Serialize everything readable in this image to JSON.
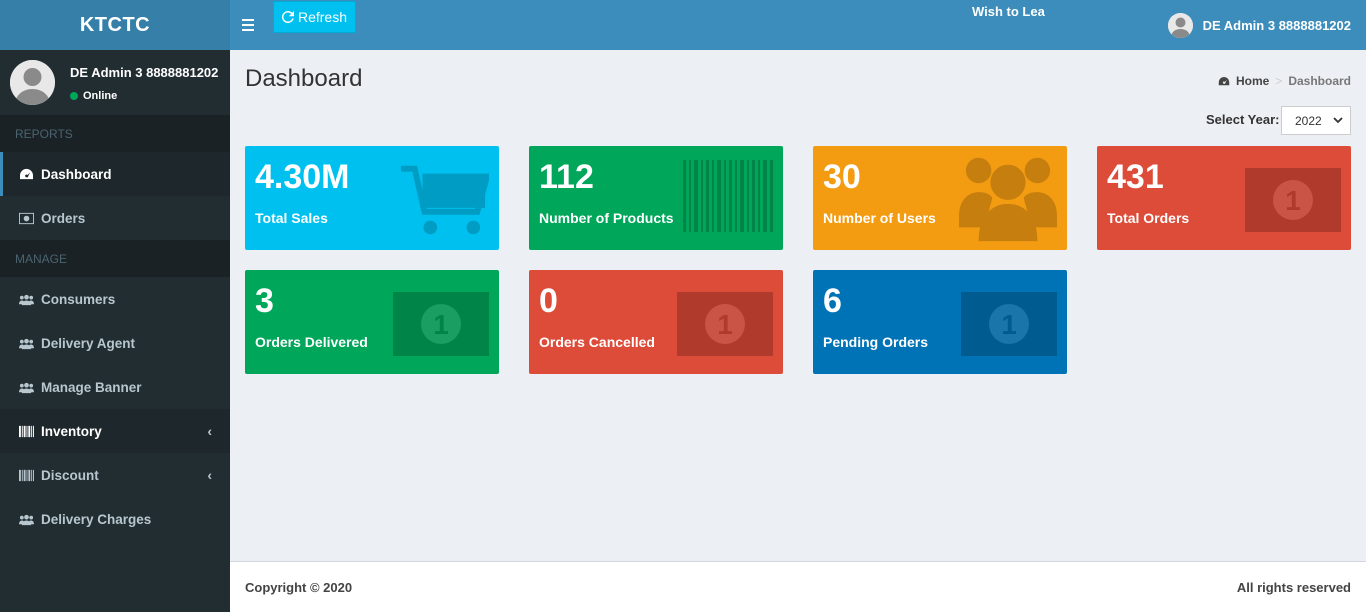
{
  "brand": "KTCTC",
  "header": {
    "refresh_label": "Refresh",
    "wish": "Wish to Lea",
    "user": "DE Admin 3 8888881202"
  },
  "sidebar": {
    "user_name": "DE Admin 3 8888881202",
    "status": "Online",
    "sections": [
      {
        "header": "REPORTS",
        "items": [
          {
            "label": "Dashboard",
            "icon": "dashboard-icon"
          },
          {
            "label": "Orders",
            "icon": "money-icon"
          }
        ]
      },
      {
        "header": "MANAGE",
        "items": [
          {
            "label": "Consumers",
            "icon": "users-icon"
          },
          {
            "label": "Delivery Agent",
            "icon": "users-icon"
          },
          {
            "label": "Manage Banner",
            "icon": "users-icon"
          },
          {
            "label": "Inventory",
            "icon": "barcode-icon"
          },
          {
            "label": "Discount",
            "icon": "barcode-icon"
          },
          {
            "label": "Delivery Charges",
            "icon": "users-icon"
          }
        ]
      }
    ]
  },
  "main": {
    "title": "Dashboard",
    "breadcrumb": {
      "home": "Home",
      "current": "Dashboard"
    },
    "year_label": "Select Year:",
    "year_value": "2022",
    "boxes": [
      {
        "value": "4.30M",
        "label": "Total Sales",
        "color": "#00c0ef",
        "icon": "cart-icon"
      },
      {
        "value": "112",
        "label": "Number of Products",
        "color": "#00a65a",
        "icon": "barcode-icon"
      },
      {
        "value": "30",
        "label": "Number of Users",
        "color": "#f39c12",
        "icon": "users-icon"
      },
      {
        "value": "431",
        "label": "Total Orders",
        "color": "#dd4b39",
        "icon": "money-icon"
      },
      {
        "value": "3",
        "label": "Orders Delivered",
        "color": "#00a65a",
        "icon": "money-icon"
      },
      {
        "value": "0",
        "label": "Orders Cancelled",
        "color": "#dd4b39",
        "icon": "money-icon"
      },
      {
        "value": "6",
        "label": "Pending Orders",
        "color": "#0073b7",
        "icon": "money-icon"
      }
    ]
  },
  "footer": {
    "copyright": "Copyright © 2020",
    "rights": "All rights reserved"
  }
}
